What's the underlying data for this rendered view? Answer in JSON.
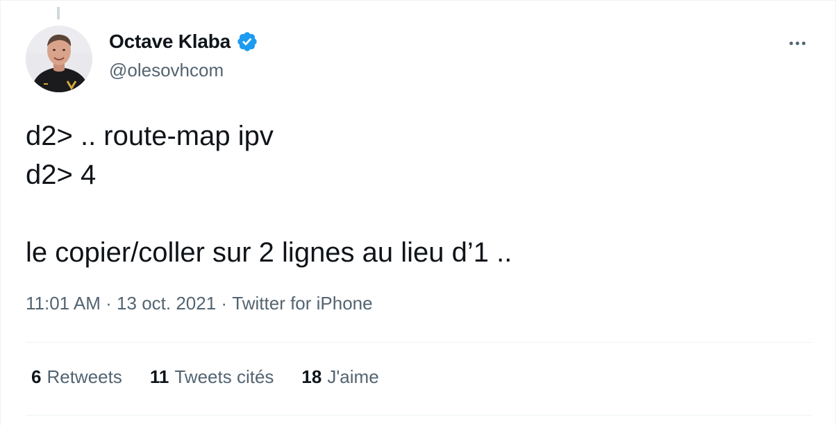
{
  "tweet": {
    "author": {
      "name": "Octave Klaba",
      "handle": "@olesovhcom",
      "verified": true
    },
    "text": "d2> .. route-map ipv\nd2> 4\n\nle copier/coller sur 2 lignes au lieu d’1 ..",
    "time": "11:01 AM",
    "date": "13 oct. 2021",
    "source": "Twitter for iPhone",
    "separator": " · ",
    "stats": [
      {
        "count": "6",
        "label": "Retweets"
      },
      {
        "count": "11",
        "label": "Tweets cités"
      },
      {
        "count": "18",
        "label": "J'aime"
      }
    ]
  },
  "colors": {
    "text": "#0f1419",
    "secondary": "#536471",
    "verified": "#1d9bf0",
    "divider": "#eff3f4"
  },
  "icons": {
    "verified": "verified-badge-icon",
    "more": "more-horizontal-icon"
  }
}
